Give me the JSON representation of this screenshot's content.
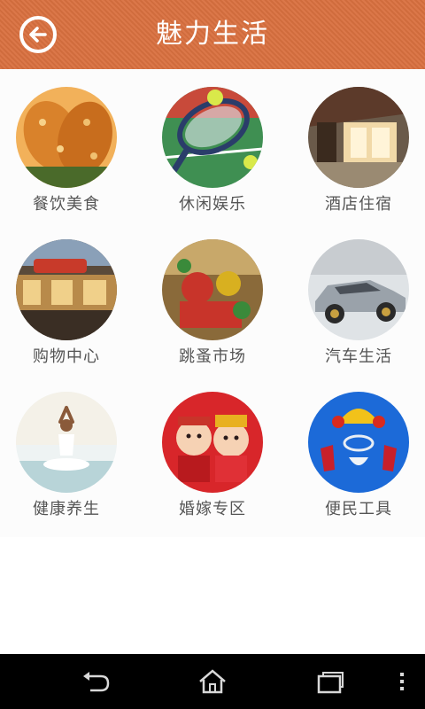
{
  "header": {
    "title": "魅力生活",
    "back_icon": "back-arrow-icon"
  },
  "categories": [
    {
      "label": "餐饮美食",
      "icon": "food-photo"
    },
    {
      "label": "休闲娱乐",
      "icon": "tennis-photo"
    },
    {
      "label": "酒店住宿",
      "icon": "hotel-photo"
    },
    {
      "label": "购物中心",
      "icon": "mall-photo"
    },
    {
      "label": "跳蚤市场",
      "icon": "market-photo"
    },
    {
      "label": "汽车生活",
      "icon": "car-photo"
    },
    {
      "label": "健康养生",
      "icon": "yoga-photo"
    },
    {
      "label": "婚嫁专区",
      "icon": "wedding-photo"
    },
    {
      "label": "便民工具",
      "icon": "tools-photo"
    }
  ],
  "navbar": {
    "icons": [
      "back-icon",
      "home-icon",
      "recent-apps-icon",
      "menu-icon"
    ]
  },
  "colors": {
    "header": "#d9703f",
    "label": "#555555",
    "navbar": "#000000"
  }
}
